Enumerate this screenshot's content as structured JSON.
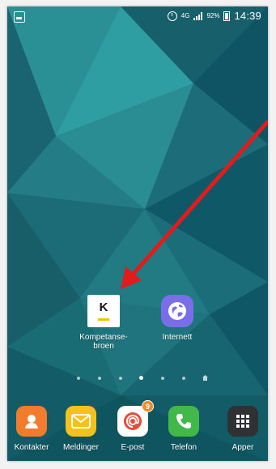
{
  "status_bar": {
    "network_type": "4G",
    "battery": "92%",
    "time": "14:39"
  },
  "home": {
    "apps": [
      {
        "label": "Kompetanse-\nbroen",
        "icon_text": "K",
        "icon": "kompetansebroen-app-icon"
      },
      {
        "label": "Internett",
        "icon": "globe-icon"
      }
    ],
    "page_indicator": {
      "count": 7,
      "active_index": 3,
      "has_home_page": true
    }
  },
  "dock": {
    "items": [
      {
        "label": "Kontakter",
        "icon": "contact-icon"
      },
      {
        "label": "Meldinger",
        "icon": "envelope-icon"
      },
      {
        "label": "E-post",
        "icon": "email-at-icon",
        "badge": "9"
      },
      {
        "label": "Telefon",
        "icon": "phone-icon"
      },
      {
        "label": "Apper",
        "icon": "app-grid-icon"
      }
    ]
  },
  "annotation": {
    "type": "arrow",
    "color": "#e21b1b"
  }
}
